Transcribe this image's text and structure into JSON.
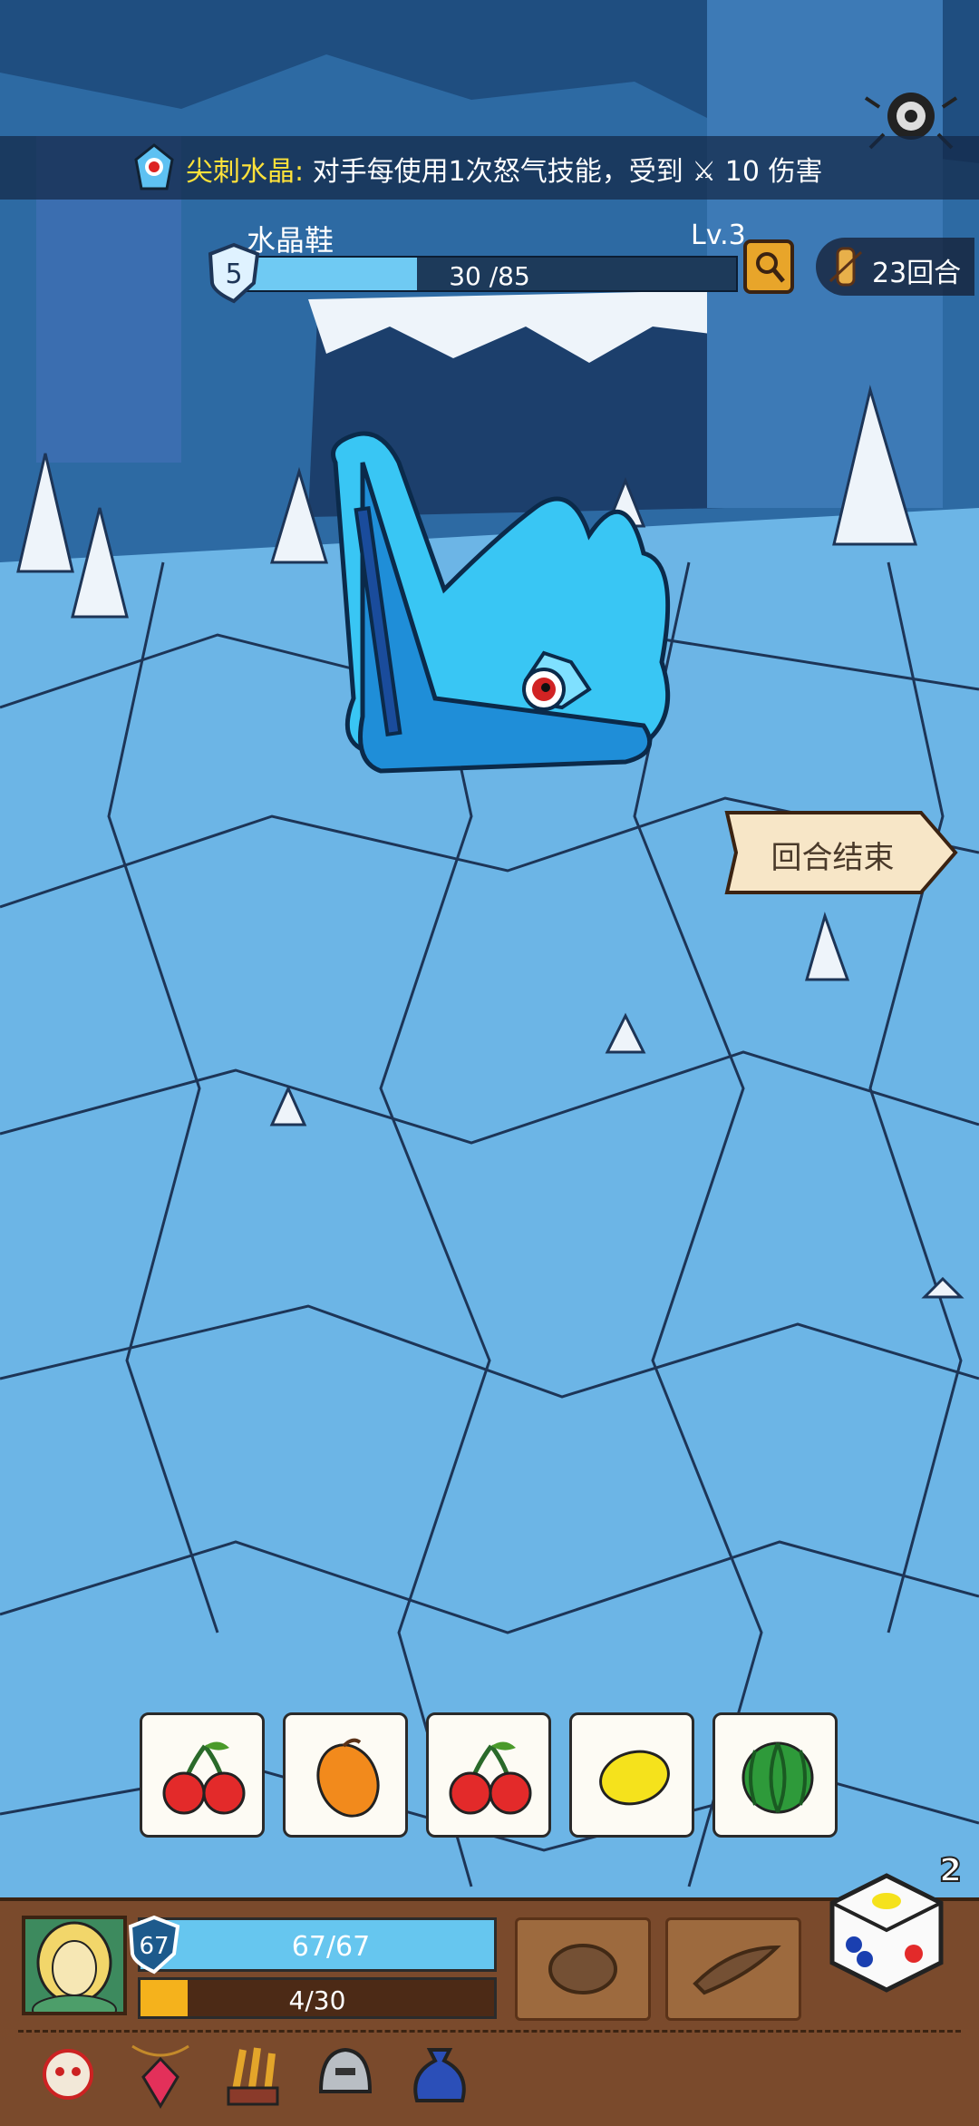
{
  "skill_banner": {
    "name": "尖刺水晶:",
    "desc": "对手每使用1次怒气技能，受到",
    "damage": "10 伤害"
  },
  "enemy": {
    "name": "水晶鞋",
    "shield": "5",
    "level": "Lv.3",
    "hp_text": "30 /85",
    "hp_fraction": 0.353
  },
  "rounds": {
    "label": "23回合"
  },
  "end_turn": {
    "label": "回合结束"
  },
  "slots": [
    "cherry-icon",
    "mango-icon",
    "cherry-icon",
    "lemon-icon",
    "watermelon-icon"
  ],
  "player": {
    "shield": "67",
    "hp_text": "67/67",
    "hp_fraction": 1.0,
    "rage_text": "4/30",
    "rage_fraction": 0.133
  },
  "dice": {
    "count": "2"
  },
  "colors": {
    "hp": "#66c6ef",
    "rage": "#f5b21c",
    "skill_name": "#ffe23a"
  }
}
